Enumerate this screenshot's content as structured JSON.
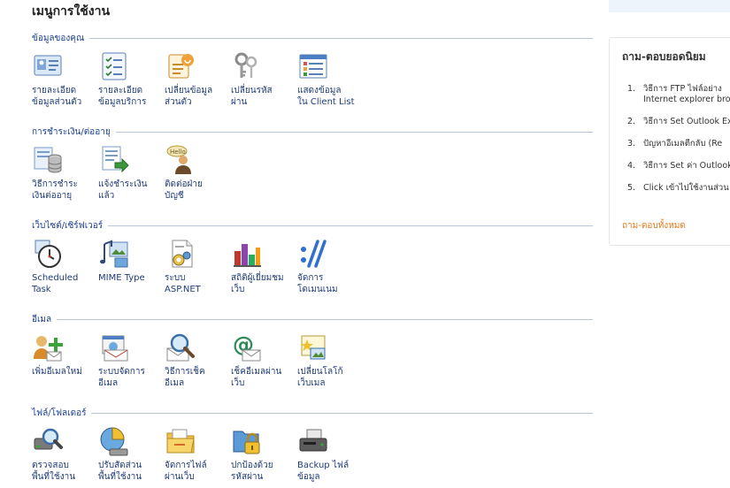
{
  "page": {
    "title": "เมนูการใช้งาน"
  },
  "sections": [
    {
      "title": "ข้อมูลของคุณ",
      "items": [
        {
          "label": "รายละเอียด\nข้อมูลส่วนตัว",
          "icon": "id-card-icon"
        },
        {
          "label": "รายละเอียด\nข้อมูลบริการ",
          "icon": "checklist-icon"
        },
        {
          "label": "เปลี่ยนข้อมูล\nส่วนตัว",
          "icon": "edit-profile-icon"
        },
        {
          "label": "เปลี่ยนรหัส\nผ่าน",
          "icon": "keys-icon"
        },
        {
          "label": "แสดงข้อมูล\nใน Client List",
          "icon": "client-list-icon"
        }
      ]
    },
    {
      "title": "การชำระเงิน/ต่ออายุ",
      "items": [
        {
          "label": "วิธีการชำระ\nเงินต่ออายุ",
          "icon": "payment-database-icon"
        },
        {
          "label": "แจ้งชำระเงิน\nแล้ว",
          "icon": "payment-notify-icon"
        },
        {
          "label": "ติดต่อฝ่าย\nบัญชี",
          "icon": "contact-accounting-icon"
        }
      ]
    },
    {
      "title": "เว็บไซต์/เซิร์ฟเวอร์",
      "items": [
        {
          "label": "Scheduled\nTask",
          "icon": "clock-icon"
        },
        {
          "label": "MIME Type",
          "icon": "mime-type-icon"
        },
        {
          "label": "ระบบ\nASP.NET",
          "icon": "asp-net-icon"
        },
        {
          "label": "สถิติผู้เยี่ยมชม\nเว็บ",
          "icon": "statistics-icon"
        },
        {
          "label": "จัดการ\nโดเมนเนม",
          "icon": "domain-icon"
        }
      ]
    },
    {
      "title": "อีเมล",
      "items": [
        {
          "label": "เพิ่มอีเมลใหม่",
          "icon": "add-email-icon"
        },
        {
          "label": "ระบบจัดการ\nอีเมล",
          "icon": "email-manager-icon"
        },
        {
          "label": "วิธีการเช็ค\nอีเมล",
          "icon": "check-email-icon"
        },
        {
          "label": "เช็คอีเมลผ่าน\nเว็บ",
          "icon": "webmail-icon"
        },
        {
          "label": "เปลี่ยนโลโก้\nเว็บเมล",
          "icon": "webmail-logo-icon"
        }
      ]
    },
    {
      "title": "ไฟล์/โฟลเดอร์",
      "items": [
        {
          "label": "ตรวจสอบ\nพื้นที่ใช้งาน",
          "icon": "disk-usage-icon"
        },
        {
          "label": "ปรับสัดส่วน\nพื้นที่ใช้งาน",
          "icon": "disk-allocation-icon"
        },
        {
          "label": "จัดการไฟล์\nผ่านเว็บ",
          "icon": "file-manager-icon"
        },
        {
          "label": "ปกป้องด้วย\nรหัสผ่าน",
          "icon": "password-protect-icon"
        },
        {
          "label": "Backup ไฟล์\nข้อมูล",
          "icon": "backup-icon"
        }
      ]
    }
  ],
  "faq_panel": {
    "title": "ถาม-ตอบยอดนิยม",
    "items": [
      {
        "num": "1.",
        "text": "วิธีการ FTP ไฟล์อย่าง\nInternet explorer bro"
      },
      {
        "num": "2.",
        "text": "วิธีการ Set Outlook Ex"
      },
      {
        "num": "3.",
        "text": "ปัญหาอีเมลตีกลับ (Re"
      },
      {
        "num": "4.",
        "text": "วิธีการ Set ค่า Outlook"
      },
      {
        "num": "5.",
        "text": "Click เข้าไปใช้งานส่วน"
      }
    ],
    "all_link": "ถาม-ตอบทั้งหมด"
  }
}
